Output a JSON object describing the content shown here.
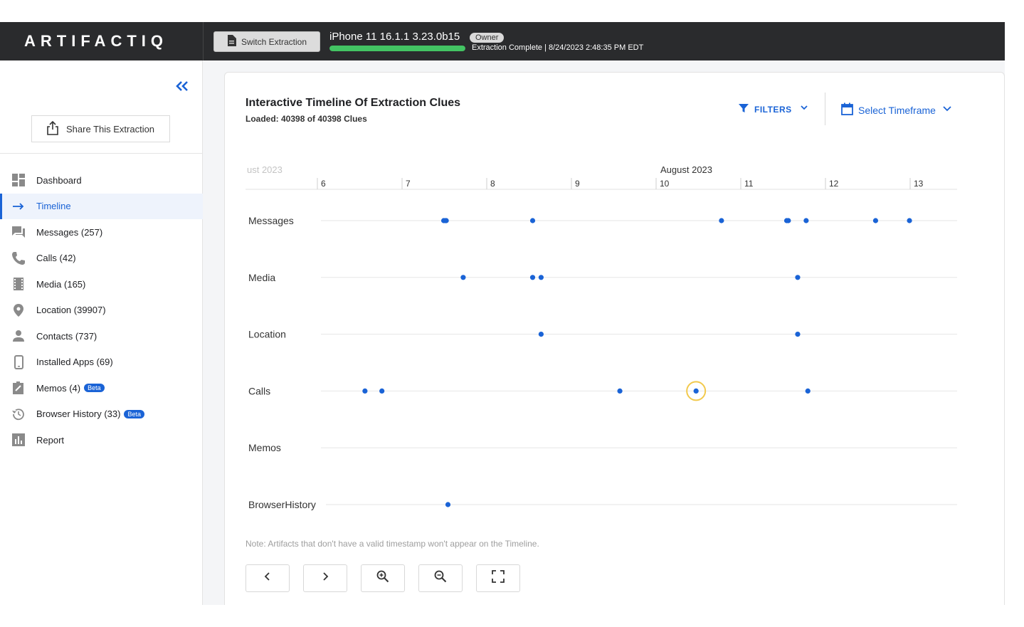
{
  "topbar": {
    "logo": "ARTIFACTIQ",
    "switch_label": "Switch Extraction",
    "device_title": "iPhone 11 16.1.1 3.23.0b15",
    "owner_badge": "Owner",
    "progress_percent": 100,
    "progress_color": "#43c463",
    "status": "Extraction Complete | 8/24/2023 2:48:35 PM EDT"
  },
  "sidebar": {
    "share_label": "Share This Extraction",
    "items": [
      {
        "label": "Dashboard",
        "icon": "dashboard-icon",
        "active": false
      },
      {
        "label": "Timeline",
        "icon": "arrow-right-icon",
        "active": true
      },
      {
        "label": "Messages (257)",
        "icon": "messages-icon",
        "active": false
      },
      {
        "label": "Calls (42)",
        "icon": "phone-icon",
        "active": false
      },
      {
        "label": "Media (165)",
        "icon": "film-icon",
        "active": false
      },
      {
        "label": "Location (39907)",
        "icon": "location-pin-icon",
        "active": false
      },
      {
        "label": "Contacts (737)",
        "icon": "person-icon",
        "active": false
      },
      {
        "label": "Installed Apps (69)",
        "icon": "smartphone-icon",
        "active": false
      },
      {
        "label": "Memos (4)",
        "icon": "memo-icon",
        "active": false,
        "badge": "Beta"
      },
      {
        "label": "Browser History (33)",
        "icon": "history-icon",
        "active": false,
        "badge": "Beta"
      },
      {
        "label": "Report",
        "icon": "report-icon",
        "active": false
      }
    ]
  },
  "main": {
    "title": "Interactive Timeline Of Extraction Clues",
    "loaded": "Loaded: 40398 of 40398 Clues",
    "filters_label": "FILTERS",
    "timeframe_label": "Select Timeframe",
    "note": "Note: Artifacts that don't have a valid timestamp won't appear on the Timeline.",
    "accent_color": "#1a63d6",
    "highlight_color": "#f2c94c"
  },
  "timeline": {
    "month_left": "ust 2023",
    "month_center": "August 2023",
    "days": [
      {
        "label": "6",
        "day": 6
      },
      {
        "label": "7",
        "day": 7
      },
      {
        "label": "8",
        "day": 8
      },
      {
        "label": "9",
        "day": 9
      },
      {
        "label": "10",
        "day": 10
      },
      {
        "label": "11",
        "day": 11
      },
      {
        "label": "12",
        "day": 12
      },
      {
        "label": "13",
        "day": 13
      }
    ],
    "rows": [
      {
        "name": "Messages",
        "events": [
          7.45,
          7.47,
          7.48,
          8.5,
          10.73,
          11.5,
          11.52,
          11.73,
          12.55,
          12.95
        ]
      },
      {
        "name": "Media",
        "events": [
          7.68,
          8.5,
          8.6,
          11.63
        ]
      },
      {
        "name": "Location",
        "events": [
          8.6,
          11.63
        ]
      },
      {
        "name": "Calls",
        "events": [
          6.52,
          6.72,
          9.53,
          10.43,
          11.75
        ],
        "highlight": 10.43
      },
      {
        "name": "Memos",
        "events": []
      },
      {
        "name": "BrowserHistory",
        "events": [
          7.5
        ]
      }
    ]
  }
}
